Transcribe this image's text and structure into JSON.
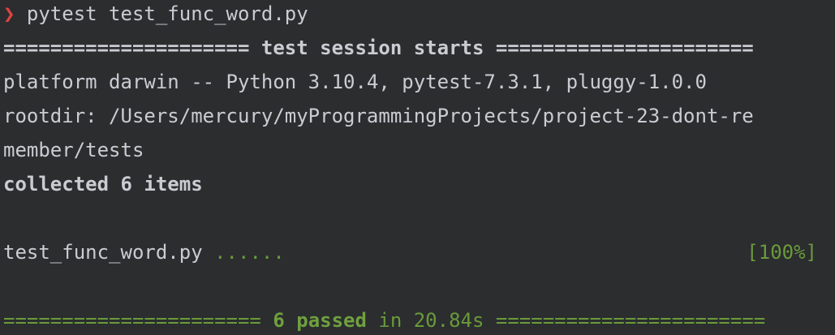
{
  "terminal": {
    "prompt": {
      "symbol": "❯",
      "command": "pytest test_func_word.py"
    },
    "header": {
      "left_rule": "=====================",
      "title": " test session starts ",
      "right_rule": "======================"
    },
    "platform_line": "platform darwin -- Python 3.10.4, pytest-7.3.1, pluggy-1.0.0",
    "rootdir_line_1": "rootdir: /Users/mercury/myProgrammingProjects/project-23-dont-re",
    "rootdir_line_2": "member/tests",
    "collected_line": "collected 6 items",
    "test_result": {
      "file": "test_func_word.py",
      "dots": " ......",
      "progress": "[100%]"
    },
    "summary": {
      "left_rule": "====================== ",
      "passed": "6 passed",
      "in_text": " in 20.84s ",
      "right_rule": "======================="
    },
    "colors": {
      "background": "#2b2d2f",
      "text": "#c9cdd2",
      "prompt": "#e0443e",
      "pass_green": "#6fa03e"
    }
  }
}
